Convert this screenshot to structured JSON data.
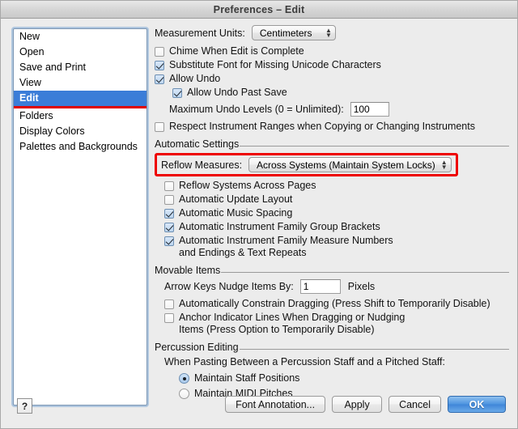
{
  "window": {
    "title": "Preferences – Edit"
  },
  "sidebar": {
    "items": [
      {
        "label": "New",
        "selected": false
      },
      {
        "label": "Open",
        "selected": false
      },
      {
        "label": "Save and Print",
        "selected": false
      },
      {
        "label": "View",
        "selected": false
      },
      {
        "label": "Edit",
        "selected": true
      },
      {
        "label": "Folders",
        "selected": false
      },
      {
        "label": "Display Colors",
        "selected": false
      },
      {
        "label": "Palettes and Backgrounds",
        "selected": false
      }
    ],
    "selected_highlight_color": "#3b7dd8",
    "annotation_color": "#ee0000"
  },
  "main": {
    "measurement_units": {
      "label": "Measurement Units:",
      "value": "Centimeters",
      "caret": "updown-arrows-icon"
    },
    "checkboxes_top": [
      {
        "label": "Chime When Edit is Complete",
        "checked": false
      },
      {
        "label": "Substitute Font for Missing Unicode Characters",
        "checked": true
      },
      {
        "label": "Allow Undo",
        "checked": true
      }
    ],
    "allow_undo_past_save": {
      "label": "Allow Undo Past Save",
      "checked": true
    },
    "max_undo": {
      "label": "Maximum Undo Levels (0 = Unlimited):",
      "value": "100"
    },
    "respect_ranges": {
      "label": "Respect Instrument Ranges when Copying or Changing Instruments",
      "checked": false
    },
    "automatic_settings": {
      "group_label": "Automatic Settings",
      "reflow_measures": {
        "label": "Reflow Measures:",
        "value": "Across Systems (Maintain System Locks)",
        "caret": "updown-arrows-icon",
        "highlighted": true
      },
      "checkboxes": [
        {
          "label": "Reflow Systems Across Pages",
          "label2": "",
          "checked": false
        },
        {
          "label": "Automatic Update Layout",
          "label2": "",
          "checked": false
        },
        {
          "label": "Automatic Music Spacing",
          "label2": "",
          "checked": true
        },
        {
          "label": "Automatic Instrument Family Group Brackets",
          "label2": "",
          "checked": true
        },
        {
          "label": "Automatic Instrument Family Measure Numbers",
          "label2": "and Endings & Text Repeats",
          "checked": true
        }
      ]
    },
    "movable_items": {
      "group_label": "Movable Items",
      "nudge": {
        "label": "Arrow Keys Nudge Items By:",
        "value": "1",
        "unit": "Pixels"
      },
      "checkboxes": [
        {
          "label": "Automatically Constrain Dragging (Press Shift to Temporarily Disable)",
          "label2": "",
          "checked": false
        },
        {
          "label": "Anchor Indicator Lines When Dragging or Nudging",
          "label2": "Items (Press Option to Temporarily Disable)",
          "checked": false
        }
      ]
    },
    "percussion_editing": {
      "group_label": "Percussion Editing",
      "prompt": "When Pasting Between a Percussion Staff and a Pitched Staff:",
      "options": [
        {
          "label": "Maintain Staff Positions",
          "selected": true
        },
        {
          "label": "Maintain MIDI Pitches",
          "selected": false
        }
      ]
    }
  },
  "footer": {
    "help": "?",
    "buttons": [
      {
        "label": "Font Annotation...",
        "default": false
      },
      {
        "label": "Apply",
        "default": false
      },
      {
        "label": "Cancel",
        "default": false
      },
      {
        "label": "OK",
        "default": true
      }
    ]
  }
}
